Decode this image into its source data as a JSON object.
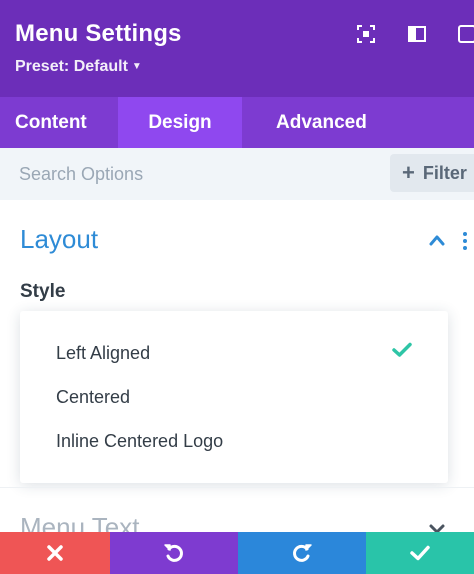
{
  "header": {
    "title": "Menu Settings",
    "preset": "Preset: Default",
    "bg_color": "#6c2eb9",
    "icons": [
      "expand-icon",
      "sidebar-icon",
      "more-icon"
    ]
  },
  "tabs": [
    {
      "label": "Content",
      "active": false
    },
    {
      "label": "Design",
      "active": true
    },
    {
      "label": "Advanced",
      "active": false
    }
  ],
  "search": {
    "placeholder": "Search Options",
    "filter_label": "Filter"
  },
  "section": {
    "title": "Layout",
    "style_label": "Style",
    "options": [
      {
        "label": "Left Aligned",
        "selected": true
      },
      {
        "label": "Centered",
        "selected": false
      },
      {
        "label": "Inline Centered Logo",
        "selected": false
      }
    ]
  },
  "next_section": {
    "title": "Menu Text"
  },
  "footer": {
    "buttons": [
      {
        "name": "discard",
        "icon": "close-icon",
        "color": "#ef5555"
      },
      {
        "name": "undo",
        "icon": "undo-icon",
        "color": "#7e3bd0"
      },
      {
        "name": "redo",
        "icon": "redo-icon",
        "color": "#2b87da"
      },
      {
        "name": "save",
        "icon": "check-icon",
        "color": "#29c4a9"
      }
    ]
  },
  "colors": {
    "accent_blue": "#2e8bd6",
    "check_green": "#2ec5a6",
    "tab_active": "#8f48ef",
    "tab_bar": "#7d3bd1"
  }
}
